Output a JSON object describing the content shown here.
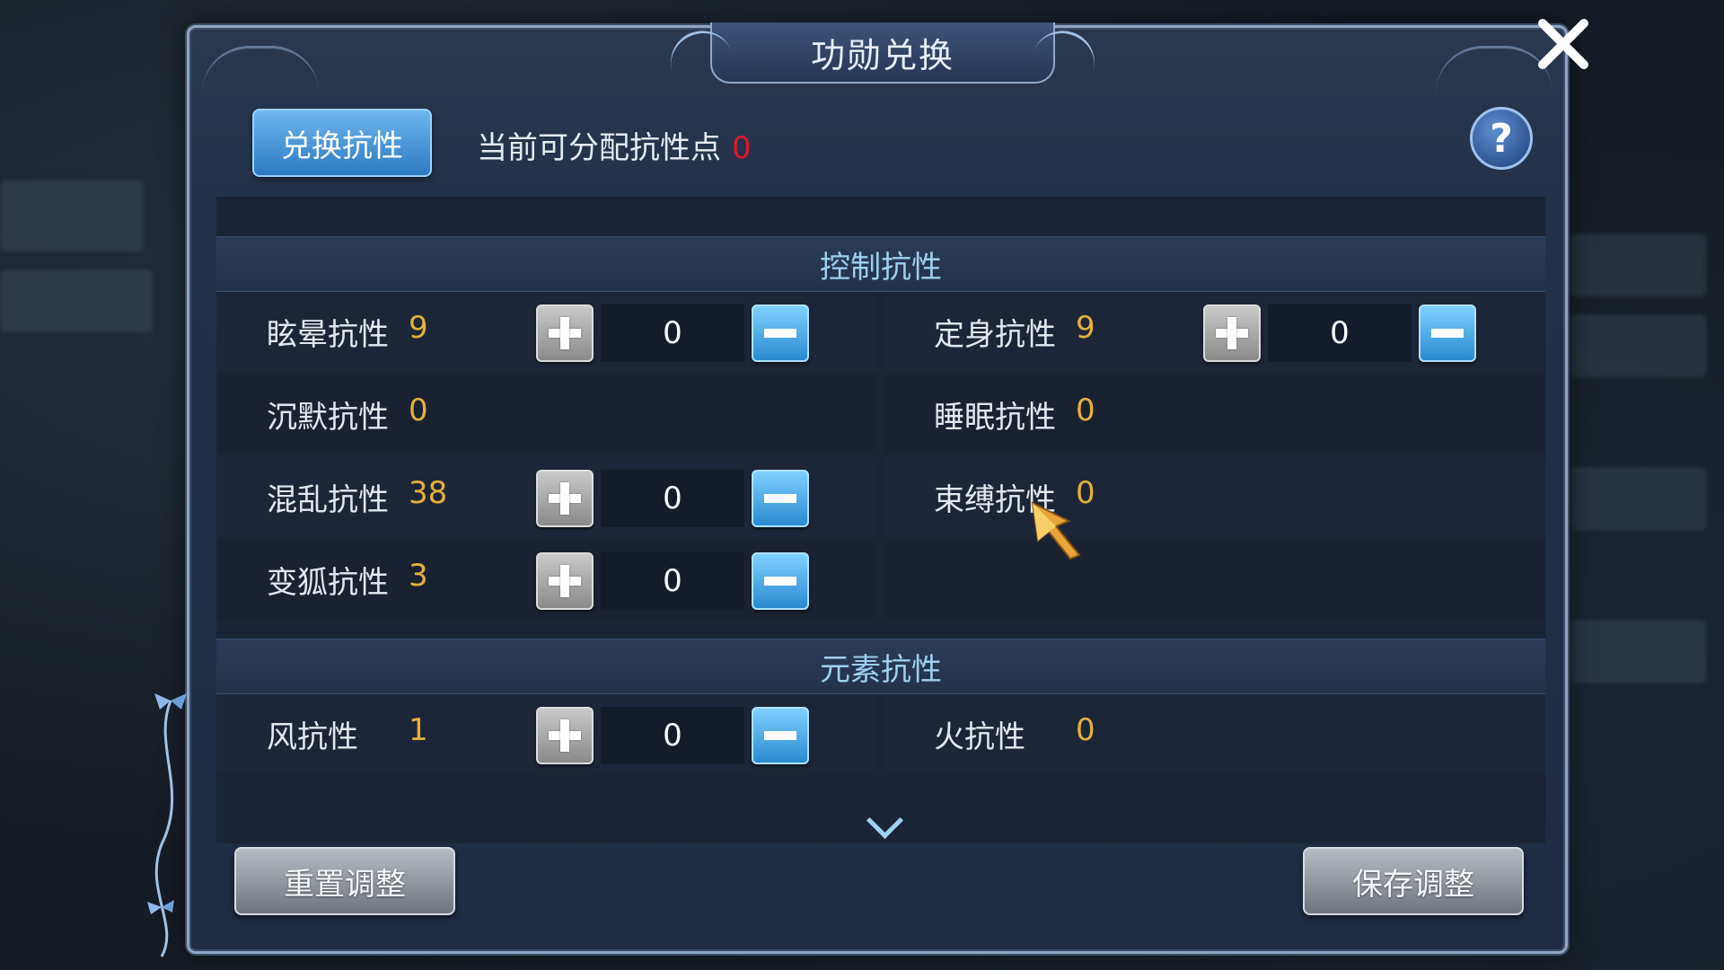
{
  "dialog": {
    "title": "功勋兑换",
    "tab_label": "兑换抗性",
    "points_label": "当前可分配抗性点",
    "points_value": "0"
  },
  "sections": {
    "control": {
      "title": "控制抗性",
      "rows": [
        {
          "left": {
            "name": "眩晕抗性",
            "value": "9",
            "count": "0"
          },
          "right": {
            "name": "定身抗性",
            "value": "9",
            "count": "0"
          }
        },
        {
          "left": {
            "name": "沉默抗性",
            "value": "0"
          },
          "right": {
            "name": "睡眠抗性",
            "value": "0"
          }
        },
        {
          "left": {
            "name": "混乱抗性",
            "value": "38",
            "count": "0"
          },
          "right": {
            "name": "束缚抗性",
            "value": "0"
          }
        },
        {
          "left": {
            "name": "变狐抗性",
            "value": "3",
            "count": "0"
          }
        }
      ]
    },
    "element": {
      "title": "元素抗性",
      "rows": [
        {
          "left": {
            "name": "风抗性",
            "value": "1",
            "count": "0"
          },
          "right": {
            "name": "火抗性",
            "value": "0"
          }
        }
      ]
    }
  },
  "buttons": {
    "reset": "重置调整",
    "save": "保存调整",
    "help": "?"
  },
  "colors": {
    "points_value": "#e3162a",
    "resistance_value": "#e5b03c",
    "section_title": "#9ed0f0",
    "tab_active": "#2c79c4"
  },
  "icons": [
    "close-icon",
    "help-icon",
    "plus-icon",
    "minus-icon",
    "chevron-down-icon",
    "cursor-icon"
  ]
}
